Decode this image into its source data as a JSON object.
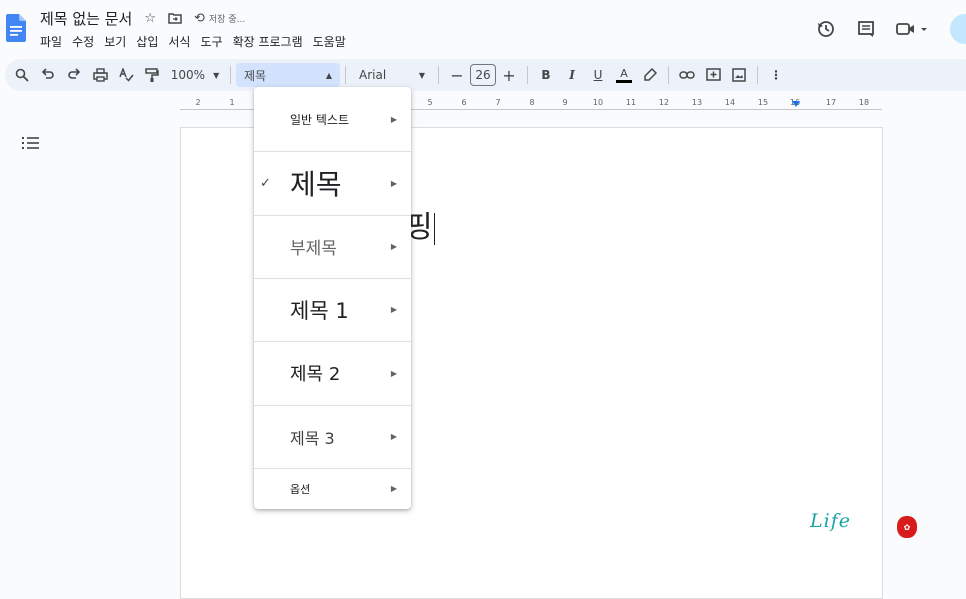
{
  "doc": {
    "title": "제목 없는 문서",
    "save_status": "저장 중..."
  },
  "menu": [
    "파일",
    "수정",
    "보기",
    "삽입",
    "서식",
    "도구",
    "확장 프로그램",
    "도움말"
  ],
  "toolbar": {
    "zoom": "100%",
    "style": "제목",
    "font": "Arial",
    "font_size": "26",
    "bold": "B",
    "italic": "I",
    "underline": "U",
    "text_color": "A"
  },
  "ruler": {
    "labels": [
      "2",
      "1",
      "5",
      "6",
      "7",
      "8",
      "9",
      "10",
      "11",
      "12",
      "13",
      "14",
      "15",
      "16",
      "17",
      "18"
    ]
  },
  "page": {
    "visible_text": "핑",
    "signature_text": "Life"
  },
  "style_menu": {
    "items": [
      {
        "label": "일반 텍스트",
        "checked": false
      },
      {
        "label": "제목",
        "checked": true
      },
      {
        "label": "부제목",
        "checked": false
      },
      {
        "label": "제목 1",
        "checked": false
      },
      {
        "label": "제목 2",
        "checked": false
      },
      {
        "label": "제목 3",
        "checked": false
      },
      {
        "label": "옵션",
        "checked": false
      }
    ]
  },
  "colors": {
    "accent": "#1a73e8",
    "toolbar_bg": "#edf2fa",
    "selected_bg": "#d3e3fd",
    "app_bg": "#f9fbfd"
  }
}
